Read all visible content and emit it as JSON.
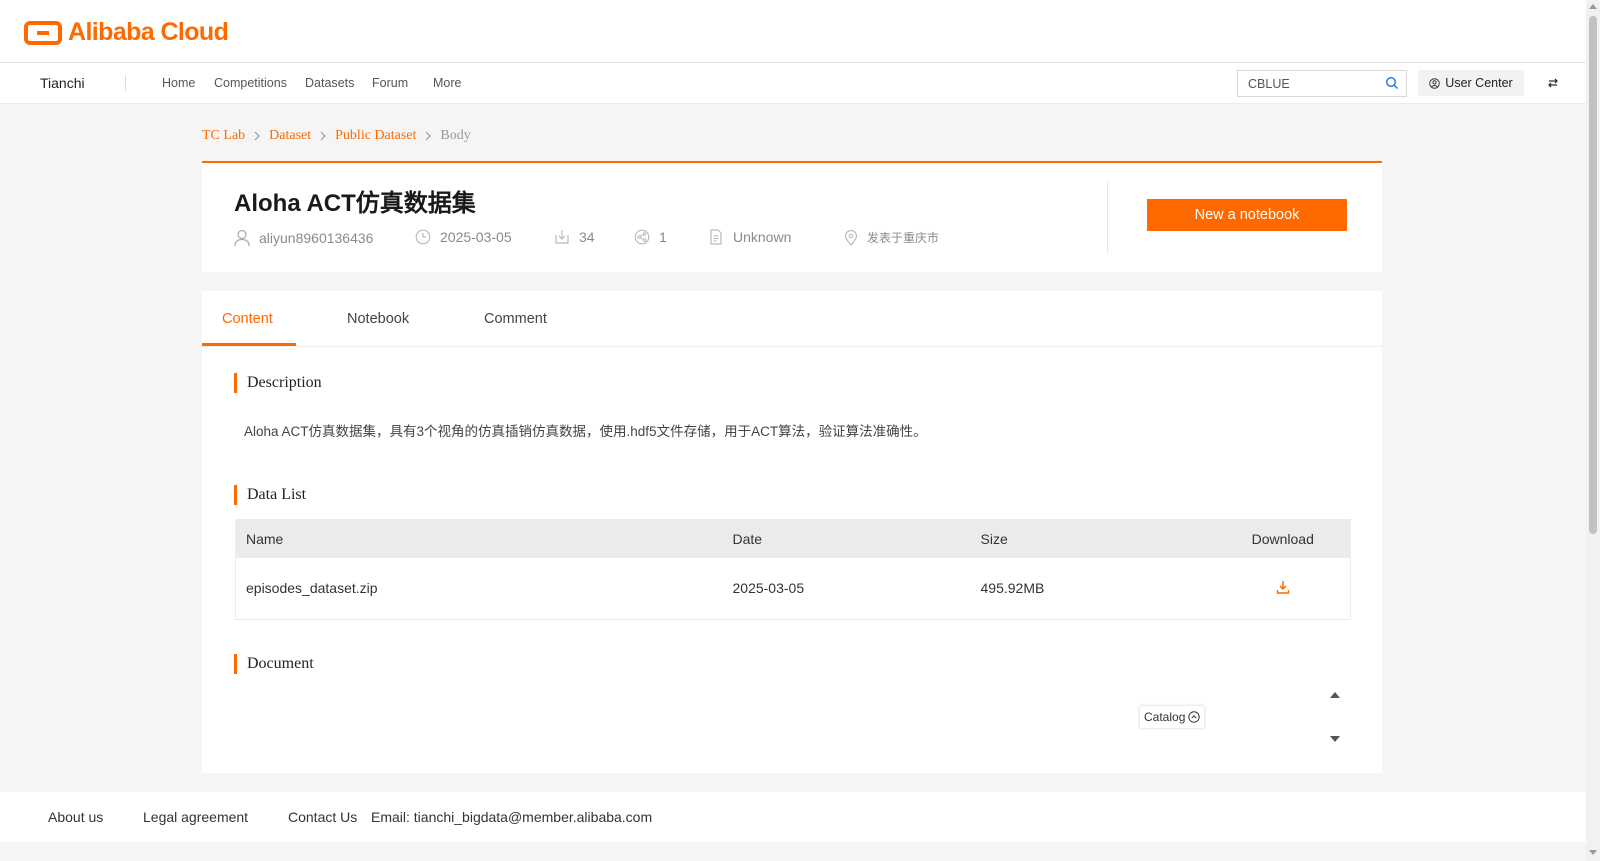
{
  "logo": {
    "text": "Alibaba Cloud",
    "icon": "alibaba-cloud-logo-icon"
  },
  "nav": {
    "brand": "Tianchi",
    "items": [
      {
        "label": "Home"
      },
      {
        "label": "Competitions"
      },
      {
        "label": "Datasets"
      },
      {
        "label": "Forum"
      },
      {
        "label": "More"
      }
    ],
    "search": {
      "value": "CBLUE",
      "icon": "search-icon"
    },
    "user_center": "User Center"
  },
  "breadcrumb": [
    {
      "label": "TC Lab"
    },
    {
      "label": "Dataset"
    },
    {
      "label": "Public Dataset"
    },
    {
      "label": "Body"
    }
  ],
  "dataset": {
    "title": "Aloha ACT仿真数据集",
    "author": "aliyun8960136436",
    "date": "2025-03-05",
    "downloads": "34",
    "shares": "1",
    "license": "Unknown",
    "location": "发表于重庆市",
    "new_notebook_label": "New a notebook"
  },
  "tabs": [
    {
      "label": "Content",
      "active": true
    },
    {
      "label": "Notebook",
      "active": false
    },
    {
      "label": "Comment",
      "active": false
    }
  ],
  "sections": {
    "description_title": "Description",
    "description_text": "Aloha ACT仿真数据集，具有3个视角的仿真插销仿真数据，使用.hdf5文件存储，用于ACT算法，验证算法准确性。",
    "data_list_title": "Data List",
    "document_title": "Document"
  },
  "table": {
    "headers": {
      "name": "Name",
      "date": "Date",
      "size": "Size",
      "download": "Download"
    },
    "rows": [
      {
        "name": "episodes_dataset.zip",
        "date": "2025-03-05",
        "size": "495.92MB"
      }
    ]
  },
  "catalog_label": "Catalog",
  "footer": {
    "about": "About us",
    "legal": "Legal agreement",
    "contact": "Contact Us",
    "email": "Email: tianchi_bigdata@member.alibaba.com"
  },
  "colors": {
    "accent": "#ff6a00",
    "background": "#f5f5f5",
    "table_header": "#ebebeb"
  }
}
